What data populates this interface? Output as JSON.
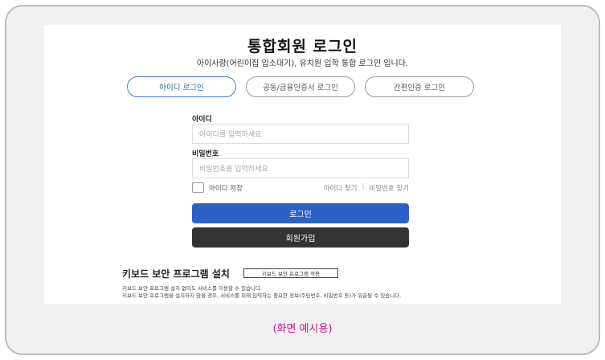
{
  "page": {
    "title": "통합회원 로그인",
    "subtitle": "아이사랑(어린이집 입소대기), 유치원 입학 통합 로그인 입니다."
  },
  "tabs": [
    {
      "label": "아이디 로그인",
      "active": true
    },
    {
      "label": "공동/금융인증서 로그인",
      "active": false
    },
    {
      "label": "간편인증 로그인",
      "active": false
    }
  ],
  "form": {
    "id_label": "아이디",
    "id_placeholder": "아이디를 입력하세요",
    "pw_label": "비밀번호",
    "pw_placeholder": "비밀번호를 입력하세요",
    "save_id_label": "아이디 저장",
    "find_id": "아이디 찾기",
    "find_pw": "비밀번호 찾기",
    "separator": "|",
    "login_button": "로그인",
    "signup_button": "회원가입"
  },
  "keyboard": {
    "title": "키보드 보안 프로그램 설치",
    "apply_button": "키보드 보안 프로그램 적용",
    "desc1": "키보드 보안 프로그램 설치 없이도 서비스를 이용할 수 있습니다.",
    "desc2": "키보드 보안 프로그램을 설치하지 않을 경우, 서비스를 위해 입력하는 중요한 정보(주민번호, 비밀번호 등)가 유출될 수 있습니다."
  },
  "caption": "(화면 예시용)",
  "colors": {
    "primary_button": "#2d62c4",
    "secondary_button": "#333333",
    "active_tab": "#2f5ea8",
    "caption": "#c0198a"
  }
}
